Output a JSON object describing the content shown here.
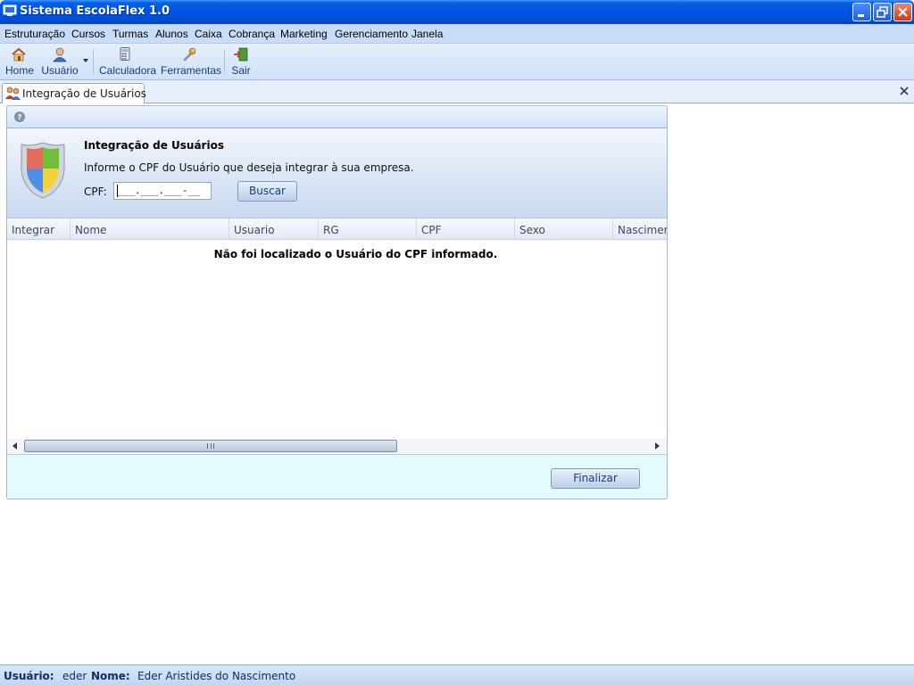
{
  "window": {
    "title": "Sistema EscolaFlex 1.0"
  },
  "menu": [
    "Estruturação",
    "Cursos",
    "Turmas",
    "Alunos",
    "Caixa",
    "Cobrança",
    "Marketing",
    "Gerenciamento",
    "Janela"
  ],
  "toolbar": {
    "home": "Home",
    "usuario": "Usuário",
    "calculadora": "Calculadora",
    "ferramentas": "Ferramentas",
    "sair": "Sair"
  },
  "tab": {
    "label": "Integração de Usuários"
  },
  "panel": {
    "title": "Integração de Usuários",
    "description": "Informe o CPF do Usuário que deseja integrar à sua empresa.",
    "cpf_label": "CPF:",
    "cpf_value": "___.___.___-__",
    "search_button": "Buscar",
    "finish_button": "Finalizar"
  },
  "grid": {
    "columns": [
      "Integrar",
      "Nome",
      "Usuario",
      "RG",
      "CPF",
      "Sexo",
      "Nascimento"
    ],
    "empty_message": "Não foi localizado o Usuário do CPF informado."
  },
  "status": {
    "user_label": "Usuário:",
    "user_value": "eder",
    "name_label": "Nome:",
    "name_value": "Eder Aristides do Nascimento"
  },
  "colors": {
    "titlebar": "#0054e3",
    "menubar": "#c8dcf8",
    "footer_panel": "#e3fbfd",
    "status_text": "#0c2f6b"
  }
}
